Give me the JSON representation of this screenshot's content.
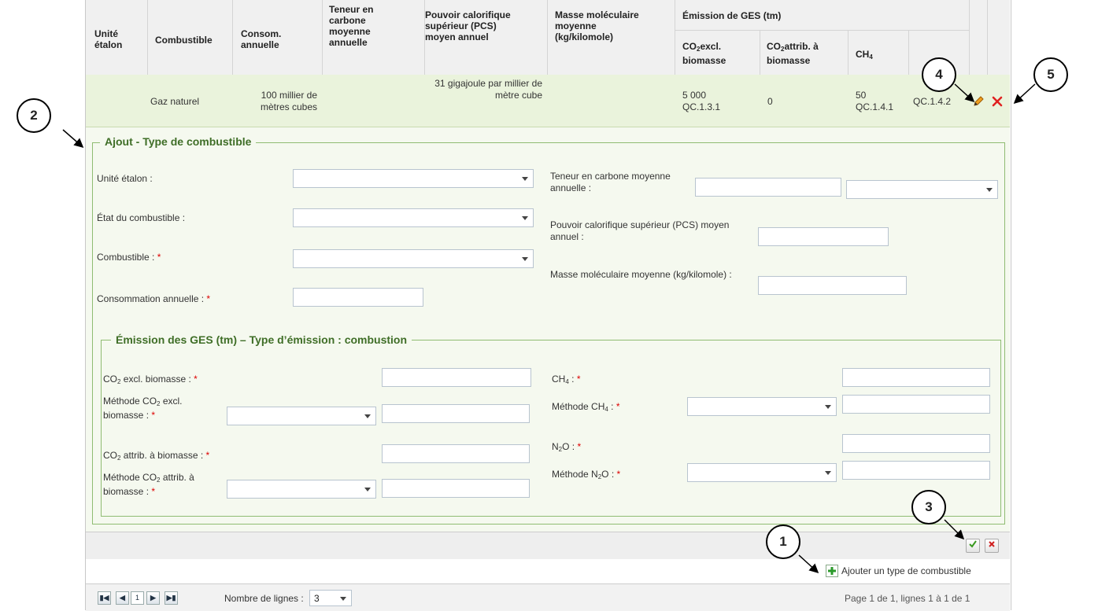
{
  "table": {
    "headers": {
      "unite": "Unité étalon",
      "combustible": "Combustible",
      "consom": "Consom. annuelle",
      "teneur": "Teneur en carbone moyenne annuelle",
      "pcs": "Pouvoir calorifique supérieur (PCS) moyen annuel",
      "masse": "Masse moléculaire moyenne (kg/kilomole)",
      "emission_group": "Émission de GES (tm)",
      "co2_excl": "excl. biomasse",
      "co2_attrib": "attrib. à biomasse",
      "ch4": "CH"
    },
    "row": {
      "unite": "",
      "combustible": "Gaz naturel",
      "consom": "100 millier de mètres cubes",
      "teneur": "",
      "pcs": "31 gigajoule par millier de mètre cube",
      "masse": "",
      "co2_excl_value": "5 000",
      "co2_excl_code": "QC.1.3.1",
      "co2_attrib_value": "0",
      "ch4_value": "50",
      "ch4_code": "QC.1.4.1",
      "n2o_code": "QC.1.4.2"
    }
  },
  "form": {
    "legend": "Ajout - Type de combustible",
    "unite_label": "Unité étalon :",
    "etat_label": "État du combustible :",
    "combustible_label": "Combustible :",
    "consommation_label": "Consommation annuelle :",
    "teneur_label": "Teneur en carbone moyenne annuelle :",
    "pcs_label": "Pouvoir calorifique supérieur (PCS) moyen annuel :",
    "masse_label": "Masse moléculaire moyenne (kg/kilomole) :",
    "required_mark": "*",
    "emission": {
      "legend": "Émission des GES (tm) – Type d’émission : combustion",
      "co2_excl_label": " excl. biomasse :",
      "methode_co2_excl_label_a": "Méthode CO",
      "methode_co2_excl_label_b": " excl.",
      "methode_co2_excl_label_c": "biomasse :",
      "co2_attrib_label": " attrib. à biomasse :",
      "methode_co2_attrib_label_a": "Méthode CO",
      "methode_co2_attrib_label_b": " attrib. à",
      "methode_co2_attrib_label_c": "biomasse :",
      "ch4_label": "CH",
      "methode_ch4_label": "Méthode CH",
      "n2o_label": "N",
      "n2o_label_b": "O :",
      "methode_n2o_label": "Méthode N",
      "methode_n2o_label_b": "O :",
      "co": "CO",
      "sub2": "2",
      "sub4": "4"
    }
  },
  "actions": {
    "add_label": "Ajouter un type de combustible"
  },
  "pager": {
    "page_value": "1",
    "rows_label": "Nombre de lignes :",
    "rows_value": "3",
    "summary": "Page 1 de 1, lignes 1 à 1 de 1"
  },
  "callouts": [
    "1",
    "2",
    "3",
    "4",
    "5"
  ]
}
